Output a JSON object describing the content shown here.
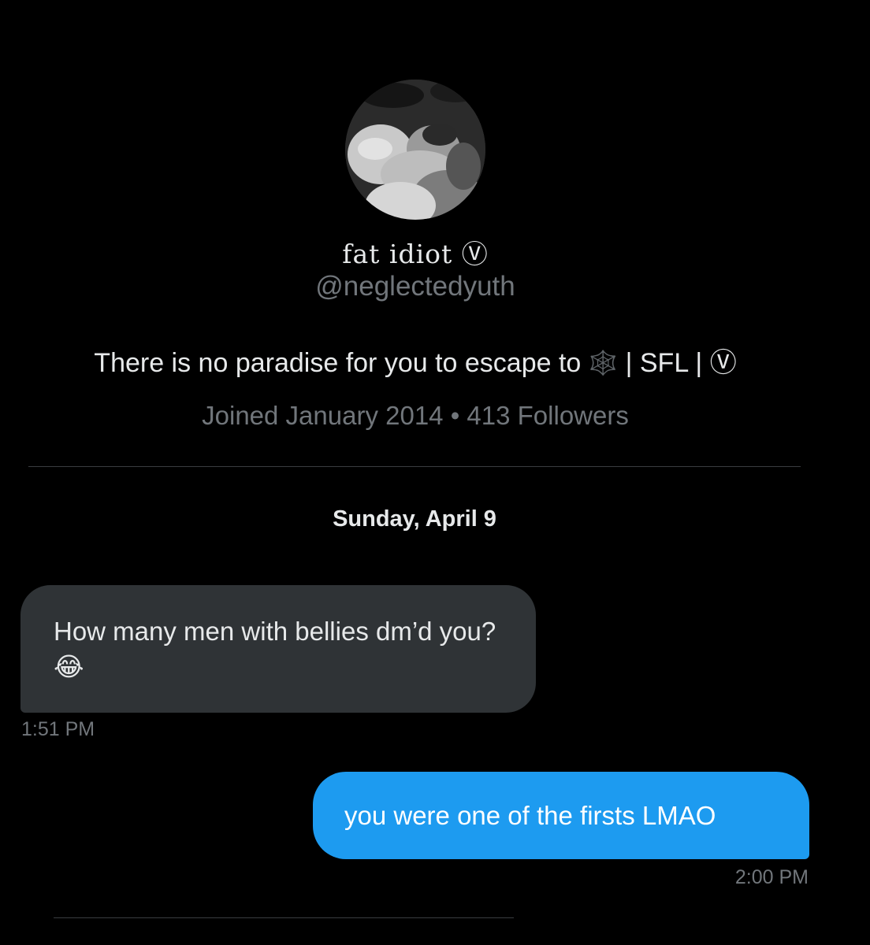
{
  "profile": {
    "avatar_icon": "profile-photo",
    "display_name": "fat idiot Ⓥ",
    "handle": "@neglectedyuth",
    "bio_text": "There is no paradise for you to escape to",
    "bio_emoji": "🕸️",
    "bio_suffix": " | SFL | Ⓥ",
    "meta": "Joined January 2014 • 413 Followers"
  },
  "conversation": {
    "date_header": "Sunday, April 9",
    "messages": [
      {
        "direction": "incoming",
        "text": "How many men with bellies dm’d you?",
        "emoji": "😂",
        "time": "1:51 PM"
      },
      {
        "direction": "outgoing",
        "text": "you were one of the firsts LMAO",
        "time": "2:00 PM"
      }
    ]
  },
  "colors": {
    "background": "#000000",
    "incoming_bubble": "#2f3336",
    "outgoing_bubble": "#1d9bf0",
    "secondary_text": "#71767b"
  }
}
